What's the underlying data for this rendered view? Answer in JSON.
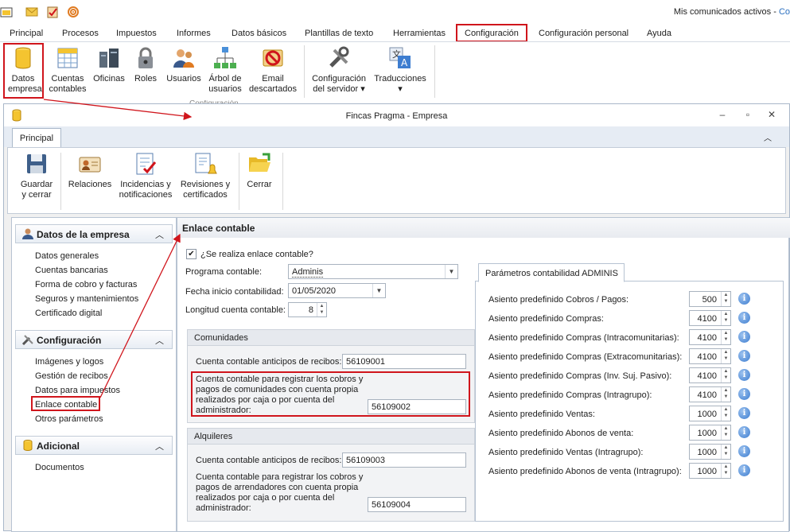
{
  "topbar": {
    "notification_label": "Mis comunicados activos - ",
    "notification_link": "Co"
  },
  "menu_tabs": [
    "Principal",
    "Procesos",
    "Impuestos",
    "Informes",
    "Datos básicos",
    "Plantillas de texto",
    "Herramientas",
    "Configuración",
    "Configuración personal",
    "Ayuda"
  ],
  "active_menu_tab": "Configuración",
  "ribbon": {
    "buttons": [
      {
        "line1": "Datos",
        "line2": "empresa"
      },
      {
        "line1": "Cuentas",
        "line2": "contables"
      },
      {
        "line1": "Oficinas",
        "line2": ""
      },
      {
        "line1": "Roles",
        "line2": ""
      },
      {
        "line1": "Usuarios",
        "line2": ""
      },
      {
        "line1": "Árbol de",
        "line2": "usuarios"
      },
      {
        "line1": "Email",
        "line2": "descartados"
      },
      {
        "line1": "Configuración",
        "line2": "del servidor ▾"
      },
      {
        "line1": "Traducciones",
        "line2": "▾"
      }
    ],
    "group_label": "Configuración"
  },
  "window": {
    "title": "Fincas Pragma - Empresa",
    "tab": "Principal",
    "buttons": [
      {
        "line1": "Guardar",
        "line2": "y cerrar"
      },
      {
        "line1": "Relaciones",
        "line2": ""
      },
      {
        "line1": "Incidencias y",
        "line2": "notificaciones"
      },
      {
        "line1": "Revisiones y",
        "line2": "certificados"
      },
      {
        "line1": "Cerrar",
        "line2": ""
      }
    ]
  },
  "nav": {
    "groups": [
      {
        "title": "Datos de la empresa",
        "items": [
          "Datos generales",
          "Cuentas bancarias",
          "Forma de cobro y facturas",
          "Seguros y mantenimientos",
          "Certificado digital"
        ]
      },
      {
        "title": "Configuración",
        "items": [
          "Imágenes y logos",
          "Gestión de recibos",
          "Datos para impuestos",
          "Enlace contable",
          "Otros parámetros"
        ]
      },
      {
        "title": "Adicional",
        "items": [
          "Documentos"
        ]
      }
    ]
  },
  "content": {
    "header": "Enlace contable",
    "checkbox_label": "¿Se realiza enlace contable?",
    "checkbox_checked": "✔",
    "programa_label": "Programa contable:",
    "programa_value": "Adminis",
    "fecha_label": "Fecha inicio contabilidad:",
    "fecha_value": "01/05/2020",
    "longitud_label": "Longitud cuenta contable:",
    "longitud_value": "8",
    "comunidades": {
      "title": "Comunidades",
      "anticipos_label": "Cuenta contable anticipos de recibos:",
      "anticipos_value": "56109001",
      "cobros_label_1": "Cuenta contable para registrar los cobros y",
      "cobros_label_2": "pagos de comunidades con cuenta propia",
      "cobros_label_3": "realizados por caja o por cuenta del",
      "cobros_label_4": "administrador:",
      "cobros_value": "56109002"
    },
    "alquileres": {
      "title": "Alquileres",
      "anticipos_label": "Cuenta contable anticipos de recibos:",
      "anticipos_value": "56109003",
      "cobros_label_1": "Cuenta contable para registrar los cobros y",
      "cobros_label_2": "pagos de arrendadores con cuenta propia",
      "cobros_label_3": "realizados por caja o por cuenta del",
      "cobros_label_4": "administrador:",
      "cobros_value": "56109004"
    },
    "params": {
      "tab": "Parámetros contabilidad ADMINIS",
      "rows": [
        {
          "label": "Asiento  predefinido Cobros / Pagos:",
          "value": "500"
        },
        {
          "label": "Asiento  predefinido Compras:",
          "value": "4100"
        },
        {
          "label": "Asiento  predefinido Compras (Intracomunitarias):",
          "value": "4100"
        },
        {
          "label": "Asiento  predefinido Compras (Extracomunitarias):",
          "value": "4100"
        },
        {
          "label": "Asiento  predefinido Compras (Inv. Suj. Pasivo):",
          "value": "4100"
        },
        {
          "label": "Asiento  predefinido Compras (Intragrupo):",
          "value": "4100"
        },
        {
          "label": "Asiento  predefinido Ventas:",
          "value": "1000"
        },
        {
          "label": "Asiento  predefinido Abonos de venta:",
          "value": "1000"
        },
        {
          "label": "Asiento  predefinido Ventas (Intragrupo):",
          "value": "1000"
        },
        {
          "label": "Asiento  predefinido Abonos de venta (Intragrupo):",
          "value": "1000"
        }
      ]
    }
  },
  "colors": {
    "highlight": "#d0151c",
    "accent": "#2a6fbf",
    "info": "#3d7dd0"
  }
}
